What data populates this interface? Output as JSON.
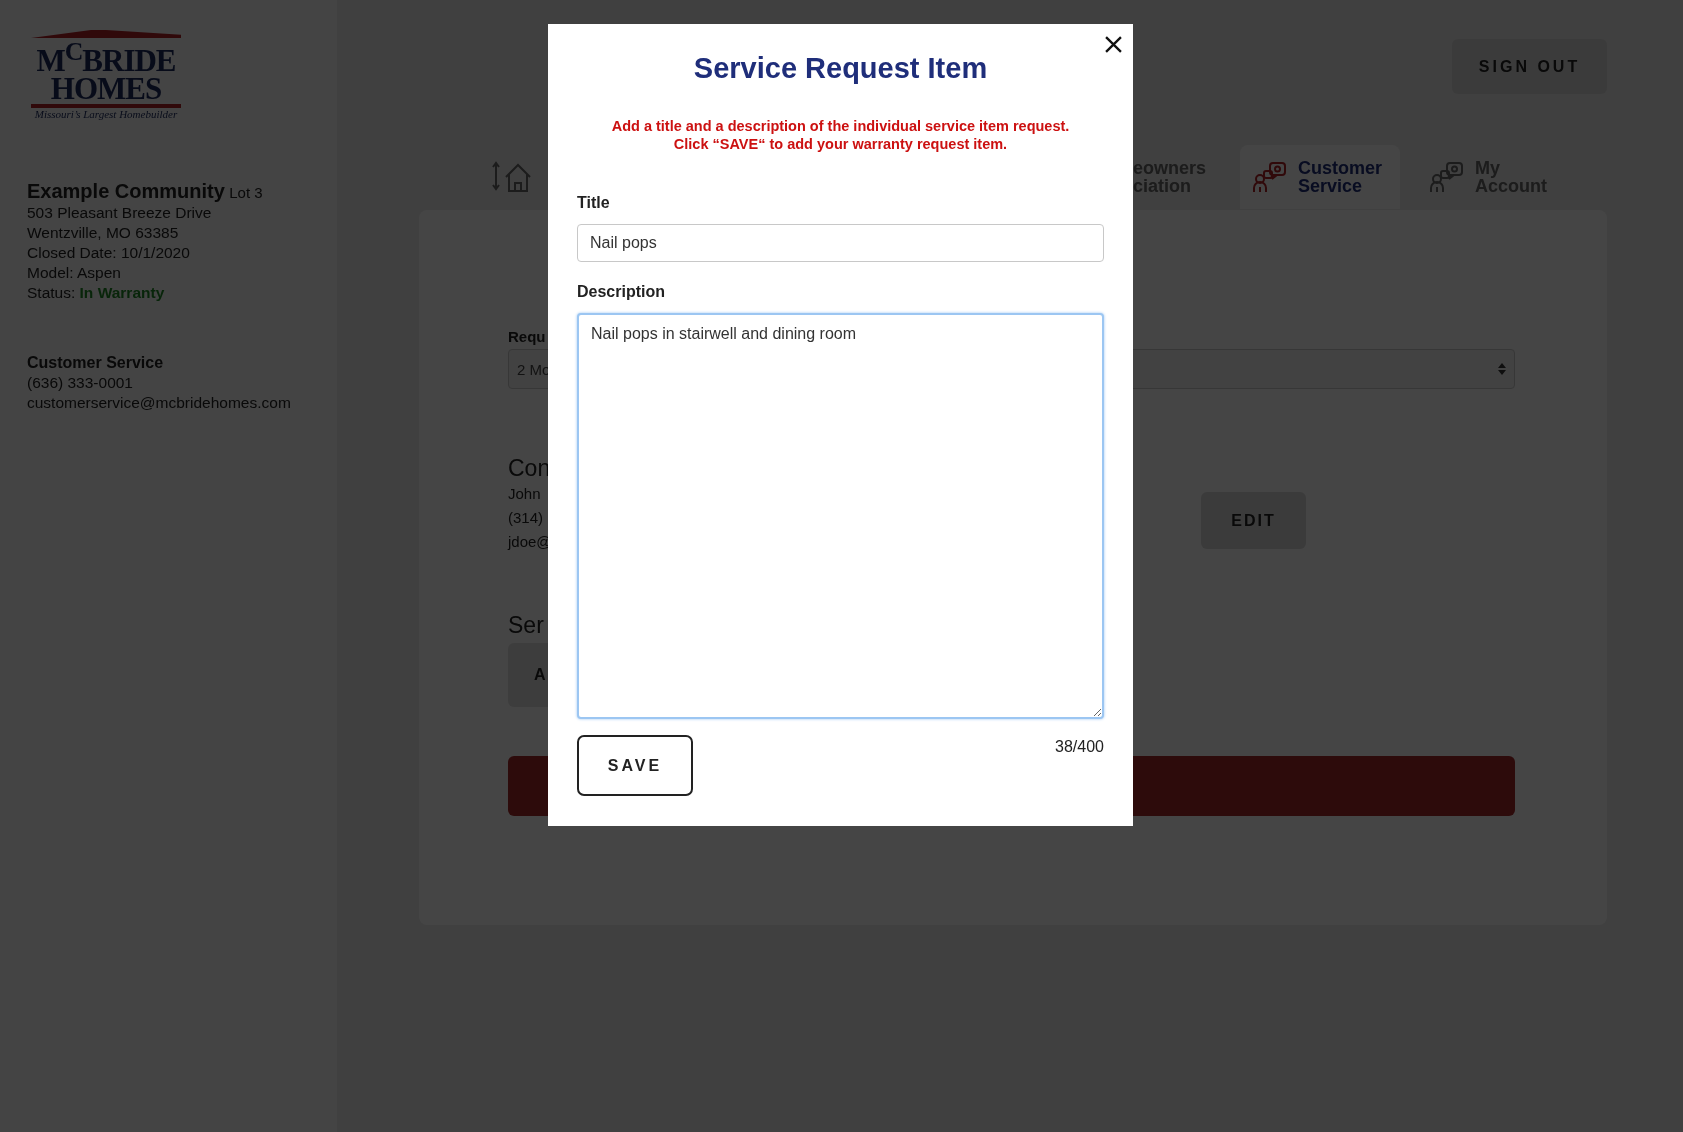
{
  "sidebar": {
    "logo": {
      "line1": "M$^{C}$BRIDE",
      "line2": "HOMES",
      "tagline": "Missouri’s Largest Homebuilder"
    },
    "community": {
      "name": "Example Community",
      "lot": "Lot 3",
      "lines": [
        "503 Pleasant Breeze Drive",
        "Wentzville, MO 63385",
        "Closed Date: 10/1/2020",
        "Model: Aspen"
      ],
      "status_label": "Status:",
      "status_value": "In Warranty"
    },
    "contact": {
      "title": "Customer Service",
      "phone": "(636) 333-0001",
      "email": "customerservice@mcbridehomes.com"
    }
  },
  "header": {
    "sign_out": "SIGN OUT"
  },
  "tabs": [
    {
      "kind": "home",
      "selected": false
    },
    {
      "kind": "text",
      "lines": [
        "eowners",
        "ciation"
      ],
      "selected": false
    },
    {
      "kind": "people",
      "lines": [
        "Customer",
        "Service"
      ],
      "selected": true
    },
    {
      "kind": "people",
      "lines": [
        "My",
        "Account"
      ],
      "selected": false
    }
  ],
  "main": {
    "request_label": "Requ",
    "request_select": "2 Mo",
    "contact_heading": "Con",
    "contact_lines": [
      "John",
      "(314)",
      "jdoe@"
    ],
    "edit_button": "EDIT",
    "service_heading": "Ser",
    "add_button": "A"
  },
  "modal": {
    "title": "Service Request Item",
    "instructions": [
      "Add a title and a description of the individual service item request.",
      "Click “SAVE“ to add your warranty request item."
    ],
    "title_label": "Title",
    "title_value": "Nail pops",
    "description_label": "Description",
    "description_value": "Nail pops in stairwell and dining room",
    "counter": "38/400",
    "save": "SAVE"
  }
}
